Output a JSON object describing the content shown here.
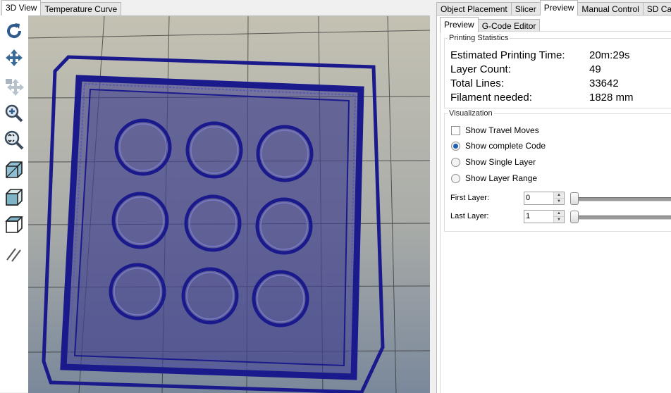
{
  "left_tabs": [
    {
      "label": "3D View",
      "active": true
    },
    {
      "label": "Temperature Curve",
      "active": false
    }
  ],
  "right_tabs": [
    {
      "label": "Object Placement",
      "active": false
    },
    {
      "label": "Slicer",
      "active": false
    },
    {
      "label": "Preview",
      "active": true
    },
    {
      "label": "Manual Control",
      "active": false
    },
    {
      "label": "SD Card",
      "active": false
    }
  ],
  "sub_tabs": [
    {
      "label": "Preview",
      "active": true
    },
    {
      "label": "G-Code Editor",
      "active": false
    }
  ],
  "toolbar": {
    "tools": [
      "rotate-icon",
      "move-icon",
      "move-object-icon",
      "zoom-icon",
      "fit-view-icon",
      "isometric-view-icon",
      "front-view-icon",
      "top-view-icon",
      "parallel-projection-icon"
    ]
  },
  "printing_statistics": {
    "title": "Printing Statistics",
    "rows": [
      {
        "label": "Estimated Printing Time:",
        "value": "20m:29s"
      },
      {
        "label": "Layer Count:",
        "value": "49"
      },
      {
        "label": "Total Lines:",
        "value": "33642"
      },
      {
        "label": "Filament needed:",
        "value": "1828 mm"
      }
    ]
  },
  "visualization": {
    "title": "Visualization",
    "show_travel_moves": {
      "label": "Show Travel Moves",
      "checked": false
    },
    "modes": [
      {
        "label": "Show complete Code",
        "selected": true
      },
      {
        "label": "Show Single Layer",
        "selected": false
      },
      {
        "label": "Show Layer Range",
        "selected": false
      }
    ],
    "first_layer": {
      "label": "First Layer:",
      "value": "0"
    },
    "last_layer": {
      "label": "Last Layer:",
      "value": "1"
    }
  },
  "colors": {
    "toolpath": "#1a1a8c",
    "toolpath_fill": "#3a3a8a",
    "bed_top": "#bfbdb0",
    "bed_bottom": "#7c8a9c",
    "radio_accent": "#1c5fb2"
  }
}
